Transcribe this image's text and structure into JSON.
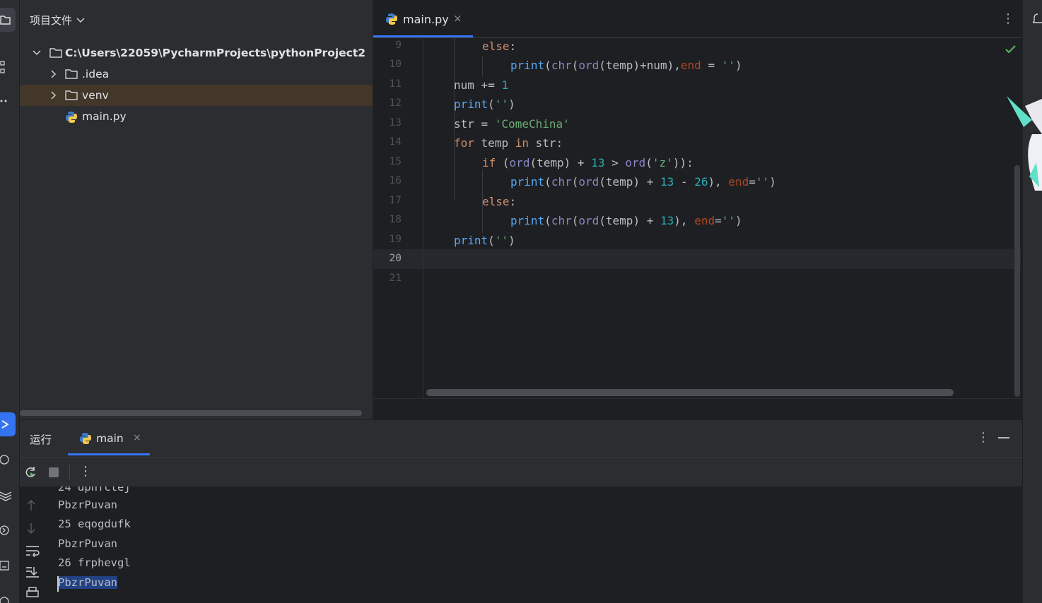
{
  "project_panel": {
    "title": "项目文件",
    "tree": [
      {
        "label": "C:\\Users\\22059\\PycharmProjects\\pythonProject2",
        "type": "folder",
        "expanded": true
      },
      {
        "label": ".idea",
        "type": "folder",
        "expanded": false
      },
      {
        "label": "venv",
        "type": "folder",
        "expanded": false,
        "selected": true
      },
      {
        "label": "main.py",
        "type": "python-file"
      }
    ]
  },
  "editor": {
    "tab": {
      "label": "main.py",
      "close": "×"
    },
    "line_numbers": [
      "9",
      "10",
      "11",
      "12",
      "13",
      "14",
      "15",
      "16",
      "17",
      "18",
      "19",
      "20",
      "21"
    ],
    "current_line": "20",
    "code_lines": [
      "else:",
      "print(chr(ord(temp)+num),end = '')",
      "num += 1",
      "print('')",
      "str = 'ComeChina'",
      "for temp in str:",
      "if (ord(temp) + 13 > ord('z')):",
      "print(chr(ord(temp) + 13 - 26), end='')",
      "else:",
      "print(chr(ord(temp) + 13), end='')",
      "print('')",
      "",
      ""
    ],
    "menu_icon": "⋮"
  },
  "run_panel": {
    "title": "运行",
    "tab": {
      "label": "main",
      "close": "×"
    },
    "menu_icon": "⋮",
    "toolbar_menu_icon": "⋮",
    "output": [
      "24 dpnfctej",
      "PbzrPuvan",
      "25 eqogdufk",
      "PbzrPuvan",
      "26 frphevgl",
      "PbzrPuvan"
    ],
    "selected_output": "PbzrPuvan"
  },
  "colors": {
    "accent": "#3574f0",
    "keyword": "#cf8e6d",
    "function": "#56a8f5",
    "builtin": "#8888c6",
    "number": "#2aacb8",
    "string": "#6aab73",
    "param": "#aa4926",
    "selection": "#43372a"
  }
}
